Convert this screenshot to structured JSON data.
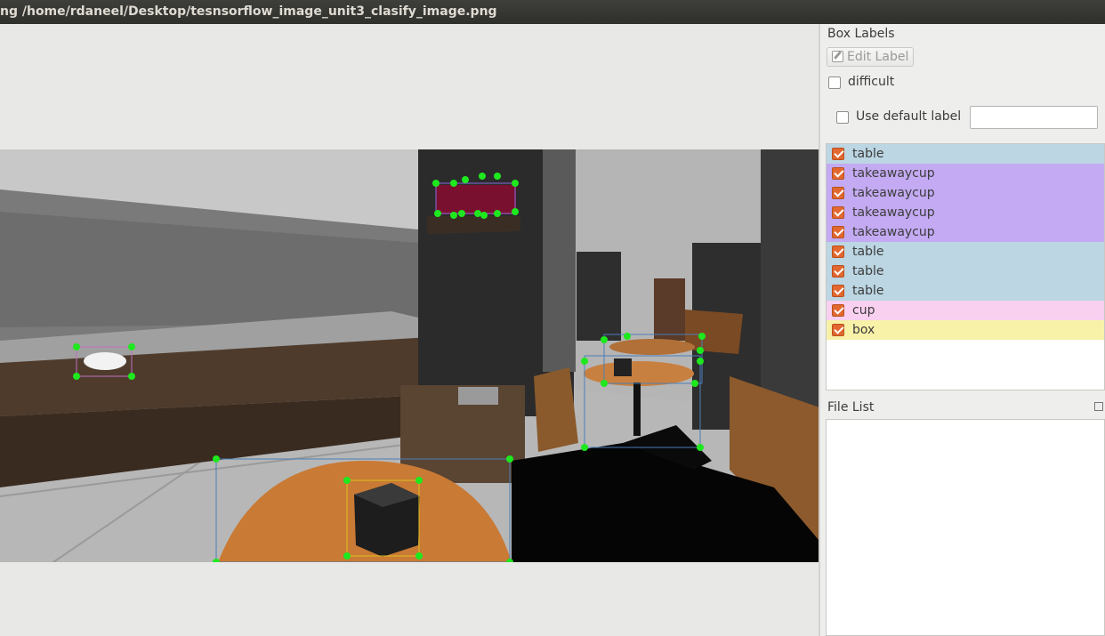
{
  "window": {
    "title": "ng /home/rdaneel/Desktop/tesnsorflow_image_unit3_clasify_image.png"
  },
  "dock": {
    "box_labels_title": "Box Labels",
    "edit_label_button": "Edit Label",
    "difficult_label": "difficult",
    "use_default_label": "Use default label",
    "default_label_value": "",
    "file_list_title": "File List"
  },
  "labels": [
    {
      "text": "table",
      "color": "#bcd6e3"
    },
    {
      "text": "takeawaycup",
      "color": "#c3aaf2"
    },
    {
      "text": "takeawaycup",
      "color": "#c3aaf2"
    },
    {
      "text": "takeawaycup",
      "color": "#c3aaf2"
    },
    {
      "text": "takeawaycup",
      "color": "#c3aaf2"
    },
    {
      "text": "table",
      "color": "#bcd6e3"
    },
    {
      "text": "table",
      "color": "#bcd6e3"
    },
    {
      "text": "table",
      "color": "#bcd6e3"
    },
    {
      "text": "cup",
      "color": "#f9d0f0"
    },
    {
      "text": "box",
      "color": "#f8f1a8"
    }
  ],
  "colors": {
    "handle": "#1ee81e",
    "box_outline": "#4a7fb8",
    "checkbox_checked": "#e2682f"
  }
}
